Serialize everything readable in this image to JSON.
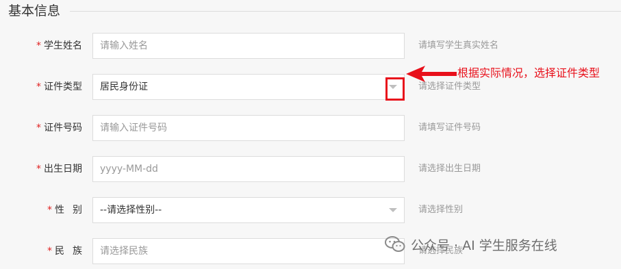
{
  "section": {
    "title": "基本信息"
  },
  "required_mark": "*",
  "fields": [
    {
      "label": "学生姓名",
      "placeholder": "请输入姓名",
      "hint": "请填写学生真实姓名"
    },
    {
      "label": "证件类型",
      "value": "居民身份证",
      "hint": "请选择证件类型"
    },
    {
      "label": "证件号码",
      "placeholder": "请输入证件号码",
      "hint": "请填写证件号码"
    },
    {
      "label": "出生日期",
      "placeholder": "yyyy-MM-dd",
      "hint": "请选择出生日期"
    },
    {
      "label_a": "性",
      "label_b": "别",
      "value": "--请选择性别--",
      "hint": "请选择性别"
    },
    {
      "label_a": "民",
      "label_b": "族",
      "placeholder": "请选择民族",
      "hint": "请选择民族"
    }
  ],
  "annotation": {
    "text": "根据实际情况，选择证件类型",
    "color": "#e8101b"
  },
  "watermark": {
    "text": "公众号 · AI 学生服务在线",
    "icon": "wechat-icon"
  }
}
